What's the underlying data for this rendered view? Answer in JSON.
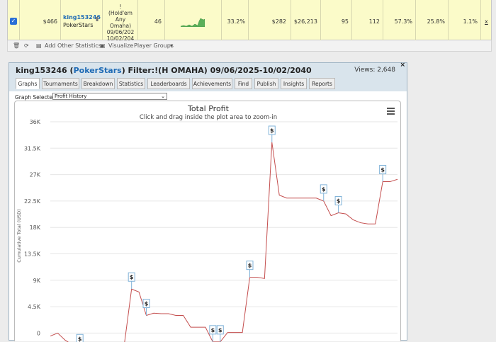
{
  "player_row": {
    "winnings": "$466",
    "player_name": "king153246",
    "site": "PokerStars",
    "filter_lines": [
      "!",
      "(Hold'em",
      "Any",
      "Omaha)",
      "09/06/202",
      "10/02/204"
    ],
    "sessions": "46",
    "stat1": "33.2%",
    "stat2": "$282",
    "stat3": "$26,213",
    "stat4": "95",
    "stat5": "112",
    "stat6": "57.3%",
    "stat7": "25.8%",
    "stat8": "1.1%",
    "remove": "x"
  },
  "toolbar": {
    "add_stats": "Add Other Statistics",
    "visualize": "Visualize",
    "player_groups": "Player Groups"
  },
  "panel": {
    "player": "king153246",
    "site": "PokerStars",
    "filter_text": "Filter:!(H OMAHA) 09/06/2025-10/02/2040",
    "views": "Views: 2,648",
    "close": "×",
    "tabs": [
      "Graphs",
      "Tournaments",
      "Breakdown",
      "Statistics",
      "Leaderboards",
      "Achievements",
      "Find",
      "Publish",
      "Insights",
      "Reports"
    ],
    "graph_selected_label": "Graph Selected:",
    "graph_selected_value": "Profit History"
  },
  "chart_data": {
    "type": "line",
    "title": "Total Profit",
    "subtitle": "Click and drag inside the plot area to zoom-in",
    "ylabel": "Cumulative Total (USD)",
    "y_ticks": [
      "36K",
      "31.5K",
      "27K",
      "22.5K",
      "18K",
      "13.5K",
      "9K",
      "4.5K",
      "0"
    ],
    "ylim": [
      -1500,
      36000
    ],
    "x": [
      0,
      1,
      2,
      3,
      4,
      5,
      6,
      7,
      8,
      9,
      10,
      11,
      12,
      13,
      14,
      15,
      16,
      17,
      18,
      19,
      20,
      21,
      22,
      23,
      24,
      25,
      26,
      27,
      28,
      29,
      30,
      31,
      32,
      33,
      34,
      35,
      36,
      37,
      38,
      39,
      40,
      41,
      42,
      43,
      44,
      45,
      46,
      47,
      48,
      49,
      50,
      51,
      52
    ],
    "values": [
      -500,
      0,
      -1200,
      -2000,
      -3000,
      -3500,
      -3000,
      -2500,
      -3000,
      -2400,
      -2100,
      7500,
      7000,
      3000,
      3400,
      3300,
      3300,
      3000,
      3000,
      1000,
      1000,
      1000,
      -1500,
      -1500,
      100,
      100,
      100,
      9500,
      9500,
      9300,
      32500,
      23500,
      23000,
      23000,
      23000,
      23000,
      23000,
      22500,
      20000,
      20500,
      20300,
      19300,
      18800,
      18600,
      18600,
      25800,
      25800,
      26200
    ],
    "markers": [
      "$",
      "$",
      "$",
      "$",
      "$",
      "$",
      "$",
      "$",
      "$",
      "$",
      "$"
    ],
    "color": "#c44e4e"
  }
}
